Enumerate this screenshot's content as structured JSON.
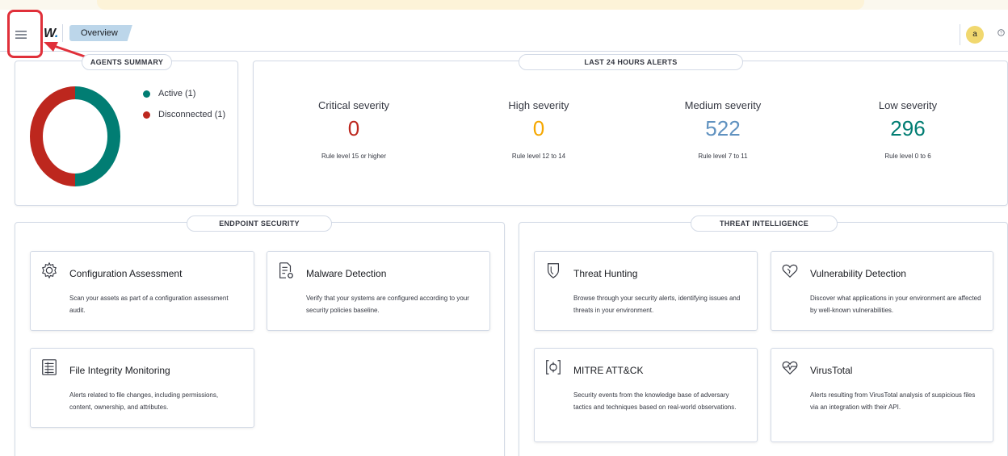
{
  "header": {
    "logo_text": "W",
    "logo_dot": ".",
    "breadcrumb": "Overview",
    "avatar_letter": "a",
    "help_icon": "help-icon"
  },
  "agents_summary": {
    "title": "AGENTS SUMMARY",
    "legend": [
      {
        "label": "Active (1)",
        "color": "#017d73"
      },
      {
        "label": "Disconnected (1)",
        "color": "#bd271e"
      }
    ],
    "donut": {
      "active_fraction": 0.5,
      "disconnected_fraction": 0.5
    }
  },
  "alerts": {
    "title": "LAST 24 HOURS ALERTS",
    "items": [
      {
        "label": "Critical severity",
        "value": "0",
        "note": "Rule level 15 or higher",
        "color": "#bd271e"
      },
      {
        "label": "High severity",
        "value": "0",
        "note": "Rule level 12 to 14",
        "color": "#f5a700"
      },
      {
        "label": "Medium severity",
        "value": "522",
        "note": "Rule level 7 to 11",
        "color": "#6092c0"
      },
      {
        "label": "Low severity",
        "value": "296",
        "note": "Rule level 0 to 6",
        "color": "#017d73"
      }
    ]
  },
  "endpoint_security": {
    "title": "ENDPOINT SECURITY",
    "cards": [
      {
        "title": "Configuration Assessment",
        "desc": "Scan your assets as part of a configuration assessment audit.",
        "icon": "gear-icon"
      },
      {
        "title": "Malware Detection",
        "desc": "Verify that your systems are configured according to your security policies baseline.",
        "icon": "document-gear-icon"
      },
      {
        "title": "File Integrity Monitoring",
        "desc": "Alerts related to file changes, including permissions, content, ownership, and attributes.",
        "icon": "file-list-icon"
      }
    ]
  },
  "threat_intelligence": {
    "title": "THREAT INTELLIGENCE",
    "cards": [
      {
        "title": "Threat Hunting",
        "desc": "Browse through your security alerts, identifying issues and threats in your environment.",
        "icon": "shield-icon"
      },
      {
        "title": "Vulnerability Detection",
        "desc": "Discover what applications in your environment are affected by well-known vulnerabilities.",
        "icon": "heart-icon"
      },
      {
        "title": "MITRE ATT&CK",
        "desc": "Security events from the knowledge base of adversary tactics and techniques based on real-world observations.",
        "icon": "target-icon"
      },
      {
        "title": "VirusTotal",
        "desc": "Alerts resulting from VirusTotal analysis of suspicious files via an integration with their API.",
        "icon": "heart-pulse-icon"
      }
    ]
  }
}
